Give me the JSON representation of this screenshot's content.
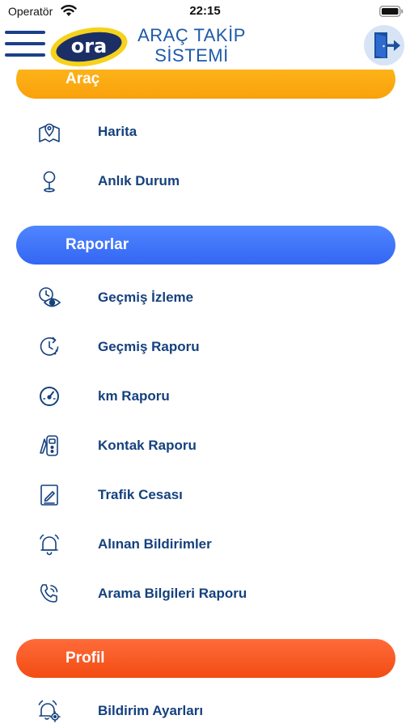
{
  "status_bar": {
    "carrier": "Operatör",
    "time": "22:15"
  },
  "header": {
    "logo_text": "ora",
    "title_line1": "ARAÇ TAKİP",
    "title_line2": "SİSTEMİ"
  },
  "colors": {
    "navy": "#15417e",
    "arac_section": "#f9a10c",
    "raporlar_section": "#3366f3",
    "profil_section": "#f24c12",
    "logo_yellow": "#f6d21c"
  },
  "sections": {
    "arac": {
      "title": "Araç",
      "items": [
        {
          "label": "Harita",
          "icon": "map-pin-icon"
        },
        {
          "label": "Anlık Durum",
          "icon": "location-marker-icon"
        }
      ]
    },
    "raporlar": {
      "title": "Raporlar",
      "items": [
        {
          "label": "Geçmiş İzleme",
          "icon": "history-eye-icon"
        },
        {
          "label": "Geçmiş Raporu",
          "icon": "history-clock-icon"
        },
        {
          "label": "km Raporu",
          "icon": "speedometer-icon"
        },
        {
          "label": "Kontak Raporu",
          "icon": "ignition-key-icon"
        },
        {
          "label": "Trafik Cesası",
          "icon": "ticket-icon"
        },
        {
          "label": "Alınan Bildirimler",
          "icon": "bell-icon"
        },
        {
          "label": "Arama Bilgileri Raporu",
          "icon": "phone-icon"
        }
      ]
    },
    "profil": {
      "title": "Profil",
      "items": [
        {
          "label": "Bildirim Ayarları",
          "icon": "notification-settings-icon"
        }
      ]
    }
  }
}
